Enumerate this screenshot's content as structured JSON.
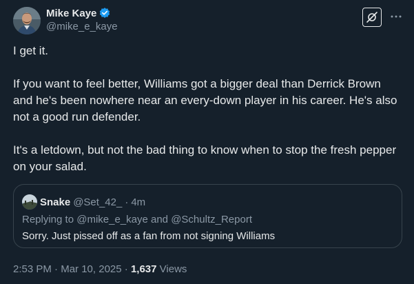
{
  "author": {
    "name": "Mike Kaye",
    "handle": "@mike_e_kaye"
  },
  "icons": {
    "verified": "verified-badge-icon",
    "grok": "grok-icon",
    "more": "more-options-icon"
  },
  "colors": {
    "background": "#15202b",
    "verified": "#1d9bf0",
    "secondary_text": "#8b98a5",
    "border": "#38444d"
  },
  "tweet": {
    "paragraphs": [
      "I get it.",
      "If you want to feel better, Williams got a bigger deal than Derrick Brown and he's been nowhere near an every-down player in his career. He's also not a good run defender.",
      "It's a letdown, but not the bad thing to know when to stop the fresh pepper on your salad."
    ]
  },
  "quote": {
    "name": "Snake",
    "handle": "@Set_42_",
    "separator": "·",
    "time": "4m",
    "replying_prefix": "Replying to",
    "replying_user1": "@mike_e_kaye",
    "replying_and": "and",
    "replying_user2": "@Schultz_Report",
    "text": "Sorry. Just pissed off as a fan from not signing Williams"
  },
  "footer": {
    "time": "2:53 PM",
    "separator": "·",
    "date": "Mar 10, 2025",
    "views_count": "1,637",
    "views_label": "Views"
  }
}
